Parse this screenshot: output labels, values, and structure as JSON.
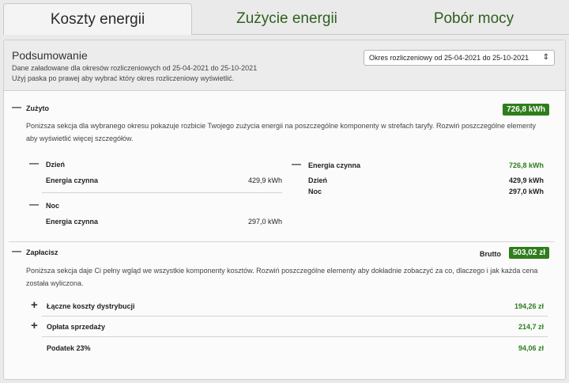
{
  "tabs": [
    {
      "label": "Koszty energii"
    },
    {
      "label": "Zużycie energii"
    },
    {
      "label": "Pobór mocy"
    }
  ],
  "summary": {
    "title": "Podsumowanie",
    "line1": "Dane załadowane dla okresów rozliczeniowych od 25-04-2021 do 25-10-2021",
    "line2": "Użyj paska po prawej aby wybrać który okres rozliczeniowy wyświetlić.",
    "select_value": "Okres rozliczeniowy od 25-04-2021 do 25-10-2021"
  },
  "used": {
    "title": "Zużyto",
    "total": "726,8 kWh",
    "description": "Poniższa sekcja dla wybranego okresu pokazuje rozbicie Twojego zużycia energii na poszczególne komponenty w strefach taryfy. Rozwiń poszczególne elementy aby wyświetlić więcej szczegółów.",
    "zones": [
      {
        "name": "Dzień",
        "item_label": "Energia czynna",
        "item_value": "429,9 kWh"
      },
      {
        "name": "Noc",
        "item_label": "Energia czynna",
        "item_value": "297,0 kWh"
      }
    ],
    "summary_block": {
      "title": "Energia czynna",
      "total": "726,8 kWh",
      "rows": [
        {
          "label": "Dzień",
          "value": "429,9 kWh"
        },
        {
          "label": "Noc",
          "value": "297,0 kWh"
        }
      ]
    }
  },
  "pay": {
    "title": "Zapłacisz",
    "brutto_label": "Brutto",
    "total": "503,02 zł",
    "description": "Poniższa sekcja daje Ci pełny wgląd we wszystkie komponenty kosztów. Rozwiń poszczególne elementy aby dokładnie zobaczyć za co, dlaczego i jak każda cena została wyliczona.",
    "items": [
      {
        "label": "Łączne koszty dystrybucji",
        "value": "194,26 zł"
      },
      {
        "label": "Opłata sprzedaży",
        "value": "214,7 zł"
      },
      {
        "label": "Podatek 23%",
        "value": "94,06 zł"
      }
    ]
  },
  "icons": {
    "collapse": "—",
    "expand": "+",
    "select_arrow": "⇕"
  },
  "colors": {
    "accent_green": "#2f7d1c",
    "text_green": "#2e7d1e",
    "tab_green": "#2e5f1e"
  }
}
